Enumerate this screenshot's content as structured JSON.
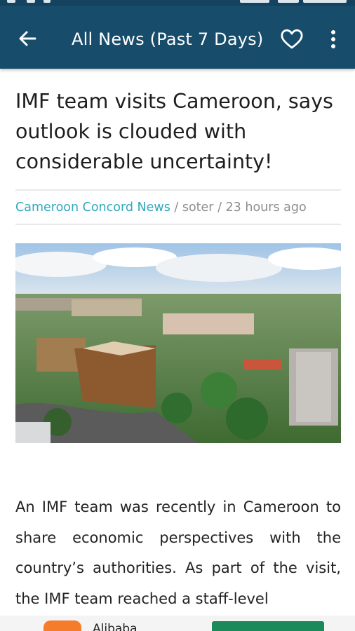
{
  "appbar": {
    "title": "All News (Past 7 Days)",
    "back_icon": "arrow-left-icon",
    "favorite_icon": "heart-outline-icon",
    "more_icon": "more-vert-icon",
    "color": "#184c6b"
  },
  "article": {
    "headline": "IMF team visits Cameroon, says outlook is clouded with considerable uncertainty!",
    "source": "Cameroon Concord News",
    "separator": " / ",
    "author": "soter",
    "time": "23 hours ago",
    "body": "An IMF team was recently in Cameroon to share economic perspectives with the country’s authorities. As part of the visit, the IMF team reached a staff-level",
    "source_color": "#32a8bd"
  },
  "ad": {
    "app_name": "Alibaba",
    "install_color": "#1b8a5a",
    "icon_color": "#f57c2a"
  }
}
